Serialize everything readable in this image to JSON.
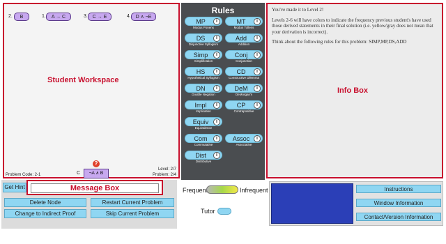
{
  "workspace": {
    "title": "Student Workspace",
    "nodes": [
      {
        "num": "2.",
        "text": "B"
      },
      {
        "num": "1.",
        "text": "A → C"
      },
      {
        "num": "3.",
        "text": "C → E"
      },
      {
        "num": "4.",
        "text": "D ∧ ¬E"
      }
    ],
    "goal_prefix": "C",
    "goal_node": "¬A ∧ B",
    "help_icon": "?",
    "problem_code": "Problem Code: 2-1",
    "level": "Level: 2/7",
    "problem": "Problem: 2/4"
  },
  "rules": {
    "title": "Rules",
    "info_icon": "i",
    "items": [
      {
        "label": "MP",
        "sub": "Modus Ponens"
      },
      {
        "label": "MT",
        "sub": "Modus Tollens"
      },
      {
        "label": "DS",
        "sub": "Disjunctive Syllogism"
      },
      {
        "label": "Add",
        "sub": "Addition"
      },
      {
        "label": "Simp",
        "sub": "Simplification"
      },
      {
        "label": "Conj",
        "sub": "Conjunction"
      },
      {
        "label": "HS",
        "sub": "Hypothetical Syllogism"
      },
      {
        "label": "CD",
        "sub": "Constructive Dilemma"
      },
      {
        "label": "DN",
        "sub": "Double Negation"
      },
      {
        "label": "DeM",
        "sub": "DeMorgan's"
      },
      {
        "label": "Impl",
        "sub": "Implication"
      },
      {
        "label": "CP",
        "sub": "Contrapositive"
      },
      {
        "label": "Equiv",
        "sub": "Equivalence"
      },
      {
        "label": "Com",
        "sub": "Commutative"
      },
      {
        "label": "Assoc",
        "sub": "Associative"
      },
      {
        "label": "Dist",
        "sub": "Distributive"
      }
    ]
  },
  "info": {
    "title": "Info Box",
    "p1": "You've made it to Level 2!",
    "p2": "Levels 2-6 will have colors to indicate the frequency previous student's have used those derived statements in their final solution (i.e. yellow/gray does not mean that your derivation is incorrect).",
    "p3": "Think about the following rules for this problem: SIMP,MP,DS,ADD"
  },
  "controls": {
    "get_hint": "Get Hint",
    "message_box_title": "Message Box",
    "delete_node": "Delete Node",
    "restart": "Restart Current Problem",
    "indirect": "Change to Indirect Proof",
    "skip": "Skip Current Problem"
  },
  "frequency": {
    "frequent": "Frequent",
    "infrequent": "Infrequent",
    "tutor": "Tutor"
  },
  "right_buttons": {
    "instructions": "Instructions",
    "window_info": "Window Information",
    "contact": "Contact/Version Information"
  },
  "colors": {
    "accent_red": "#c8102e",
    "button_blue": "#8fd6f2",
    "node_purple": "#c7a8ef",
    "rules_bg": "#4a4d50",
    "blue_box": "#2b3fb7"
  }
}
